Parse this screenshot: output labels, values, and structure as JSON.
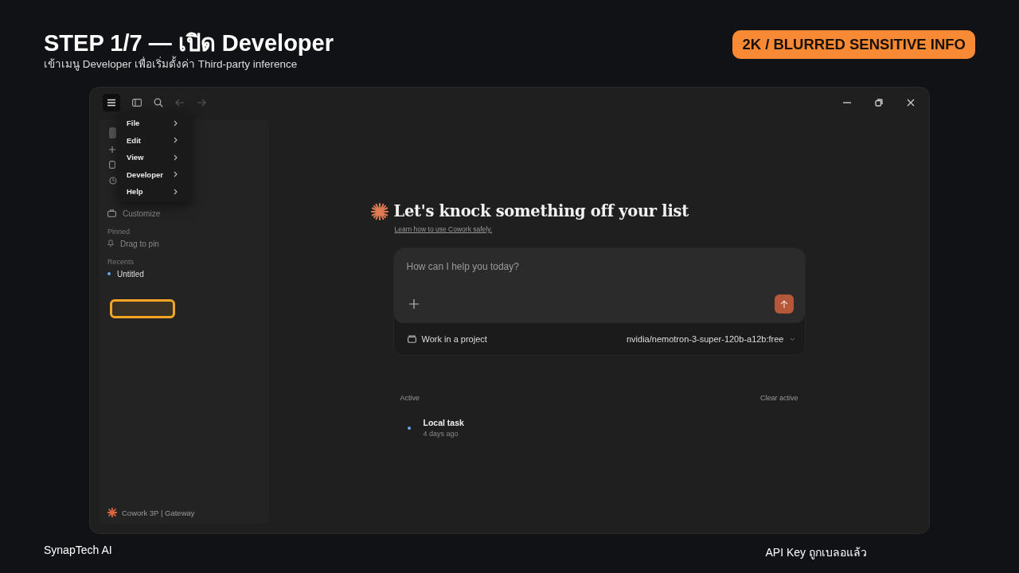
{
  "header": {
    "title": "STEP 1/7 — เปิด Developer",
    "subtitle": "เข้าเมนู Developer เพื่อเริ่มตั้งค่า Third-party inference",
    "badge": "2K / BLURRED SENSITIVE INFO"
  },
  "menu": {
    "items": [
      {
        "label": "File"
      },
      {
        "label": "Edit"
      },
      {
        "label": "View"
      },
      {
        "label": "Developer"
      },
      {
        "label": "Help"
      }
    ]
  },
  "sidebar": {
    "customize": "Customize",
    "sections": [
      {
        "heading": "Pinned",
        "items": [
          {
            "label": "Drag to pin",
            "kind": "hint"
          }
        ]
      },
      {
        "heading": "Recents",
        "items": [
          {
            "label": "Untitled",
            "kind": "chat"
          }
        ]
      }
    ],
    "footer": "Cowork 3P | Gateway"
  },
  "main": {
    "heading": "Let's knock something off your list",
    "link": "Learn how to use Cowork safely.",
    "composer": {
      "placeholder": "How can I help you today?",
      "project": "Work in a project",
      "model": "nvidia/nemotron-3-super-120b-a12b:free"
    },
    "active": {
      "heading": "Active",
      "clear": "Clear active",
      "tasks": [
        {
          "title": "Local task",
          "time": "4 days ago"
        }
      ]
    }
  },
  "footer": {
    "left": "SynapTech AI",
    "right": "API Key ถูกเบลอแล้ว"
  }
}
